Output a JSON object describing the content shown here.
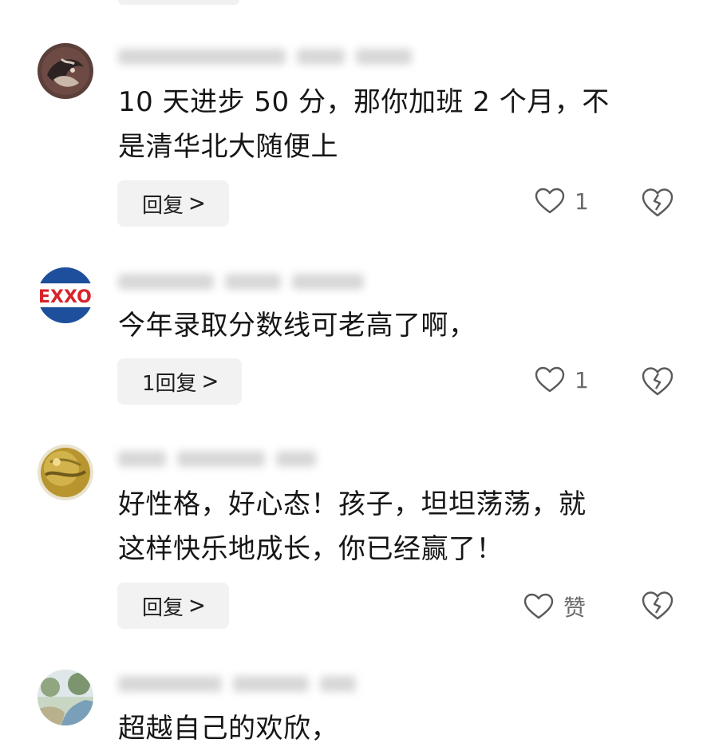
{
  "comments": [
    {
      "text": "10 天进步 50 分，那你加班 2 个月，不\n是清华北大随便上",
      "reply_label": "回复",
      "reply_chevron": ">",
      "like_label": "1",
      "avatar_icon": "dragon-art-avatar"
    },
    {
      "text": "今年录取分数线可老高了啊，",
      "reply_label": "1回复",
      "reply_chevron": ">",
      "like_label": "1",
      "avatar_icon": "exxon-logo-avatar"
    },
    {
      "text": "好性格，好心态！孩子，坦坦荡荡，就\n这样快乐地成长，你已经赢了！",
      "reply_label": "回复",
      "reply_chevron": ">",
      "like_label": "赞",
      "avatar_icon": "golden-sphere-avatar"
    },
    {
      "text": "超越自己的欢欣，",
      "avatar_icon": "park-path-avatar"
    }
  ],
  "colors": {
    "reply_bg": "#f2f2f2",
    "icon_gray": "#5a5a5a",
    "text": "#161616",
    "count": "#6b6b6b"
  }
}
